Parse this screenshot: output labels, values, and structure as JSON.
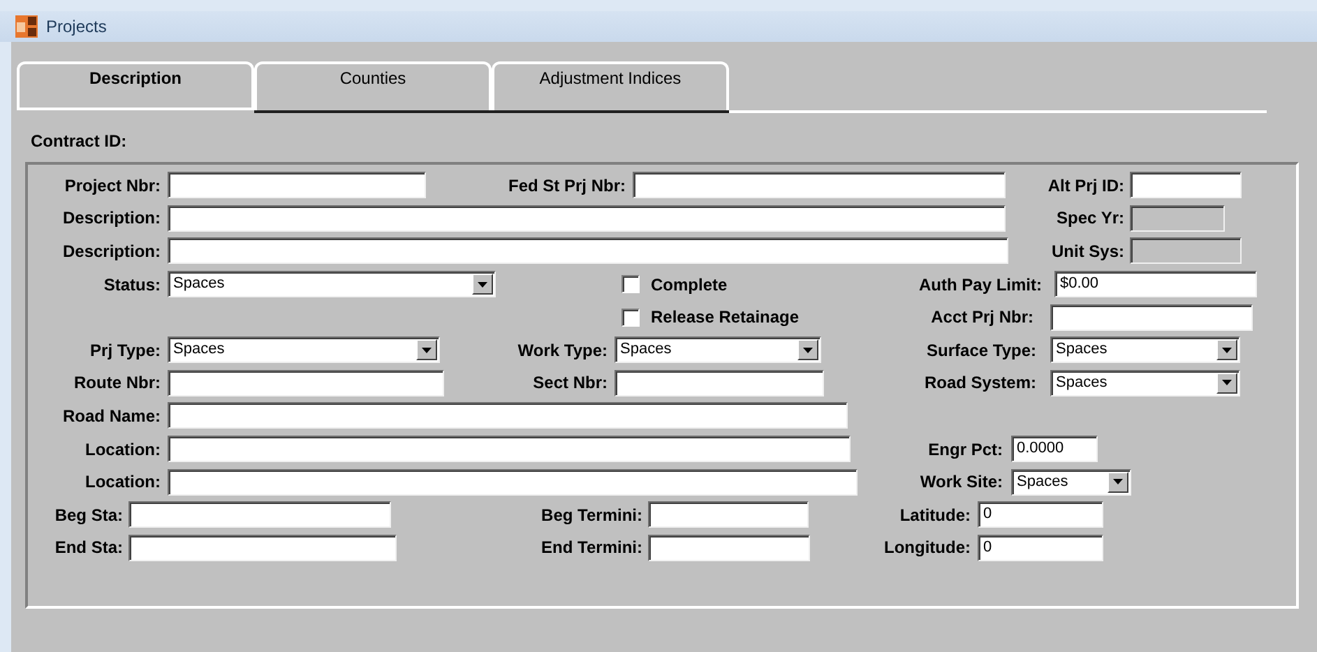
{
  "window": {
    "title": "Projects"
  },
  "tabs": [
    {
      "label": "Description",
      "selected": true
    },
    {
      "label": "Counties",
      "selected": false
    },
    {
      "label": "Adjustment Indices",
      "selected": false
    }
  ],
  "contract_id": {
    "label": "Contract ID:"
  },
  "form": {
    "rows": [
      {
        "fields": [
          {
            "kind": "text",
            "label": "Project Nbr:"
          },
          {
            "kind": "text",
            "label": "Fed St Prj Nbr:"
          },
          {
            "kind": "text",
            "label": "Alt Prj ID:"
          }
        ]
      },
      {
        "fields": [
          {
            "kind": "text",
            "label": "Description:"
          },
          {
            "kind": "text",
            "label": "Spec Yr:",
            "disabled": true
          }
        ]
      },
      {
        "fields": [
          {
            "kind": "text",
            "label": "Description:"
          },
          {
            "kind": "text",
            "label": "Unit Sys:",
            "disabled": true
          }
        ]
      },
      {
        "fields": [
          {
            "kind": "combo",
            "label": "Status:",
            "value": "Spaces"
          },
          {
            "kind": "check",
            "label": "Complete",
            "checked": false
          },
          {
            "kind": "text",
            "label": "Auth Pay Limit:",
            "value": "$0.00"
          }
        ]
      },
      {
        "fields": [
          {
            "kind": "check",
            "label": "Release Retainage",
            "checked": false
          },
          {
            "kind": "text",
            "label": "Acct Prj Nbr:"
          }
        ]
      },
      {
        "fields": [
          {
            "kind": "combo",
            "label": "Prj Type:",
            "value": "Spaces"
          },
          {
            "kind": "combo",
            "label": "Work Type:",
            "value": "Spaces"
          },
          {
            "kind": "combo",
            "label": "Surface Type:",
            "value": "Spaces"
          }
        ]
      },
      {
        "fields": [
          {
            "kind": "text",
            "label": "Route Nbr:"
          },
          {
            "kind": "text",
            "label": "Sect Nbr:"
          },
          {
            "kind": "combo",
            "label": "Road System:",
            "value": "Spaces"
          }
        ]
      },
      {
        "fields": [
          {
            "kind": "text",
            "label": "Road Name:"
          }
        ]
      },
      {
        "fields": [
          {
            "kind": "text",
            "label": "Location:"
          },
          {
            "kind": "text",
            "label": "Engr Pct:",
            "value": "0.0000"
          }
        ]
      },
      {
        "fields": [
          {
            "kind": "text",
            "label": "Location:"
          },
          {
            "kind": "combo",
            "label": "Work Site:",
            "value": "Spaces"
          }
        ]
      },
      {
        "fields": [
          {
            "kind": "text",
            "label": "Beg Sta:"
          },
          {
            "kind": "text",
            "label": "Beg Termini:"
          },
          {
            "kind": "text",
            "label": "Latitude:",
            "value": "0"
          }
        ]
      },
      {
        "fields": [
          {
            "kind": "text",
            "label": "End Sta:"
          },
          {
            "kind": "text",
            "label": "End Termini:"
          },
          {
            "kind": "text",
            "label": "Longitude:",
            "value": "0"
          }
        ]
      }
    ]
  }
}
